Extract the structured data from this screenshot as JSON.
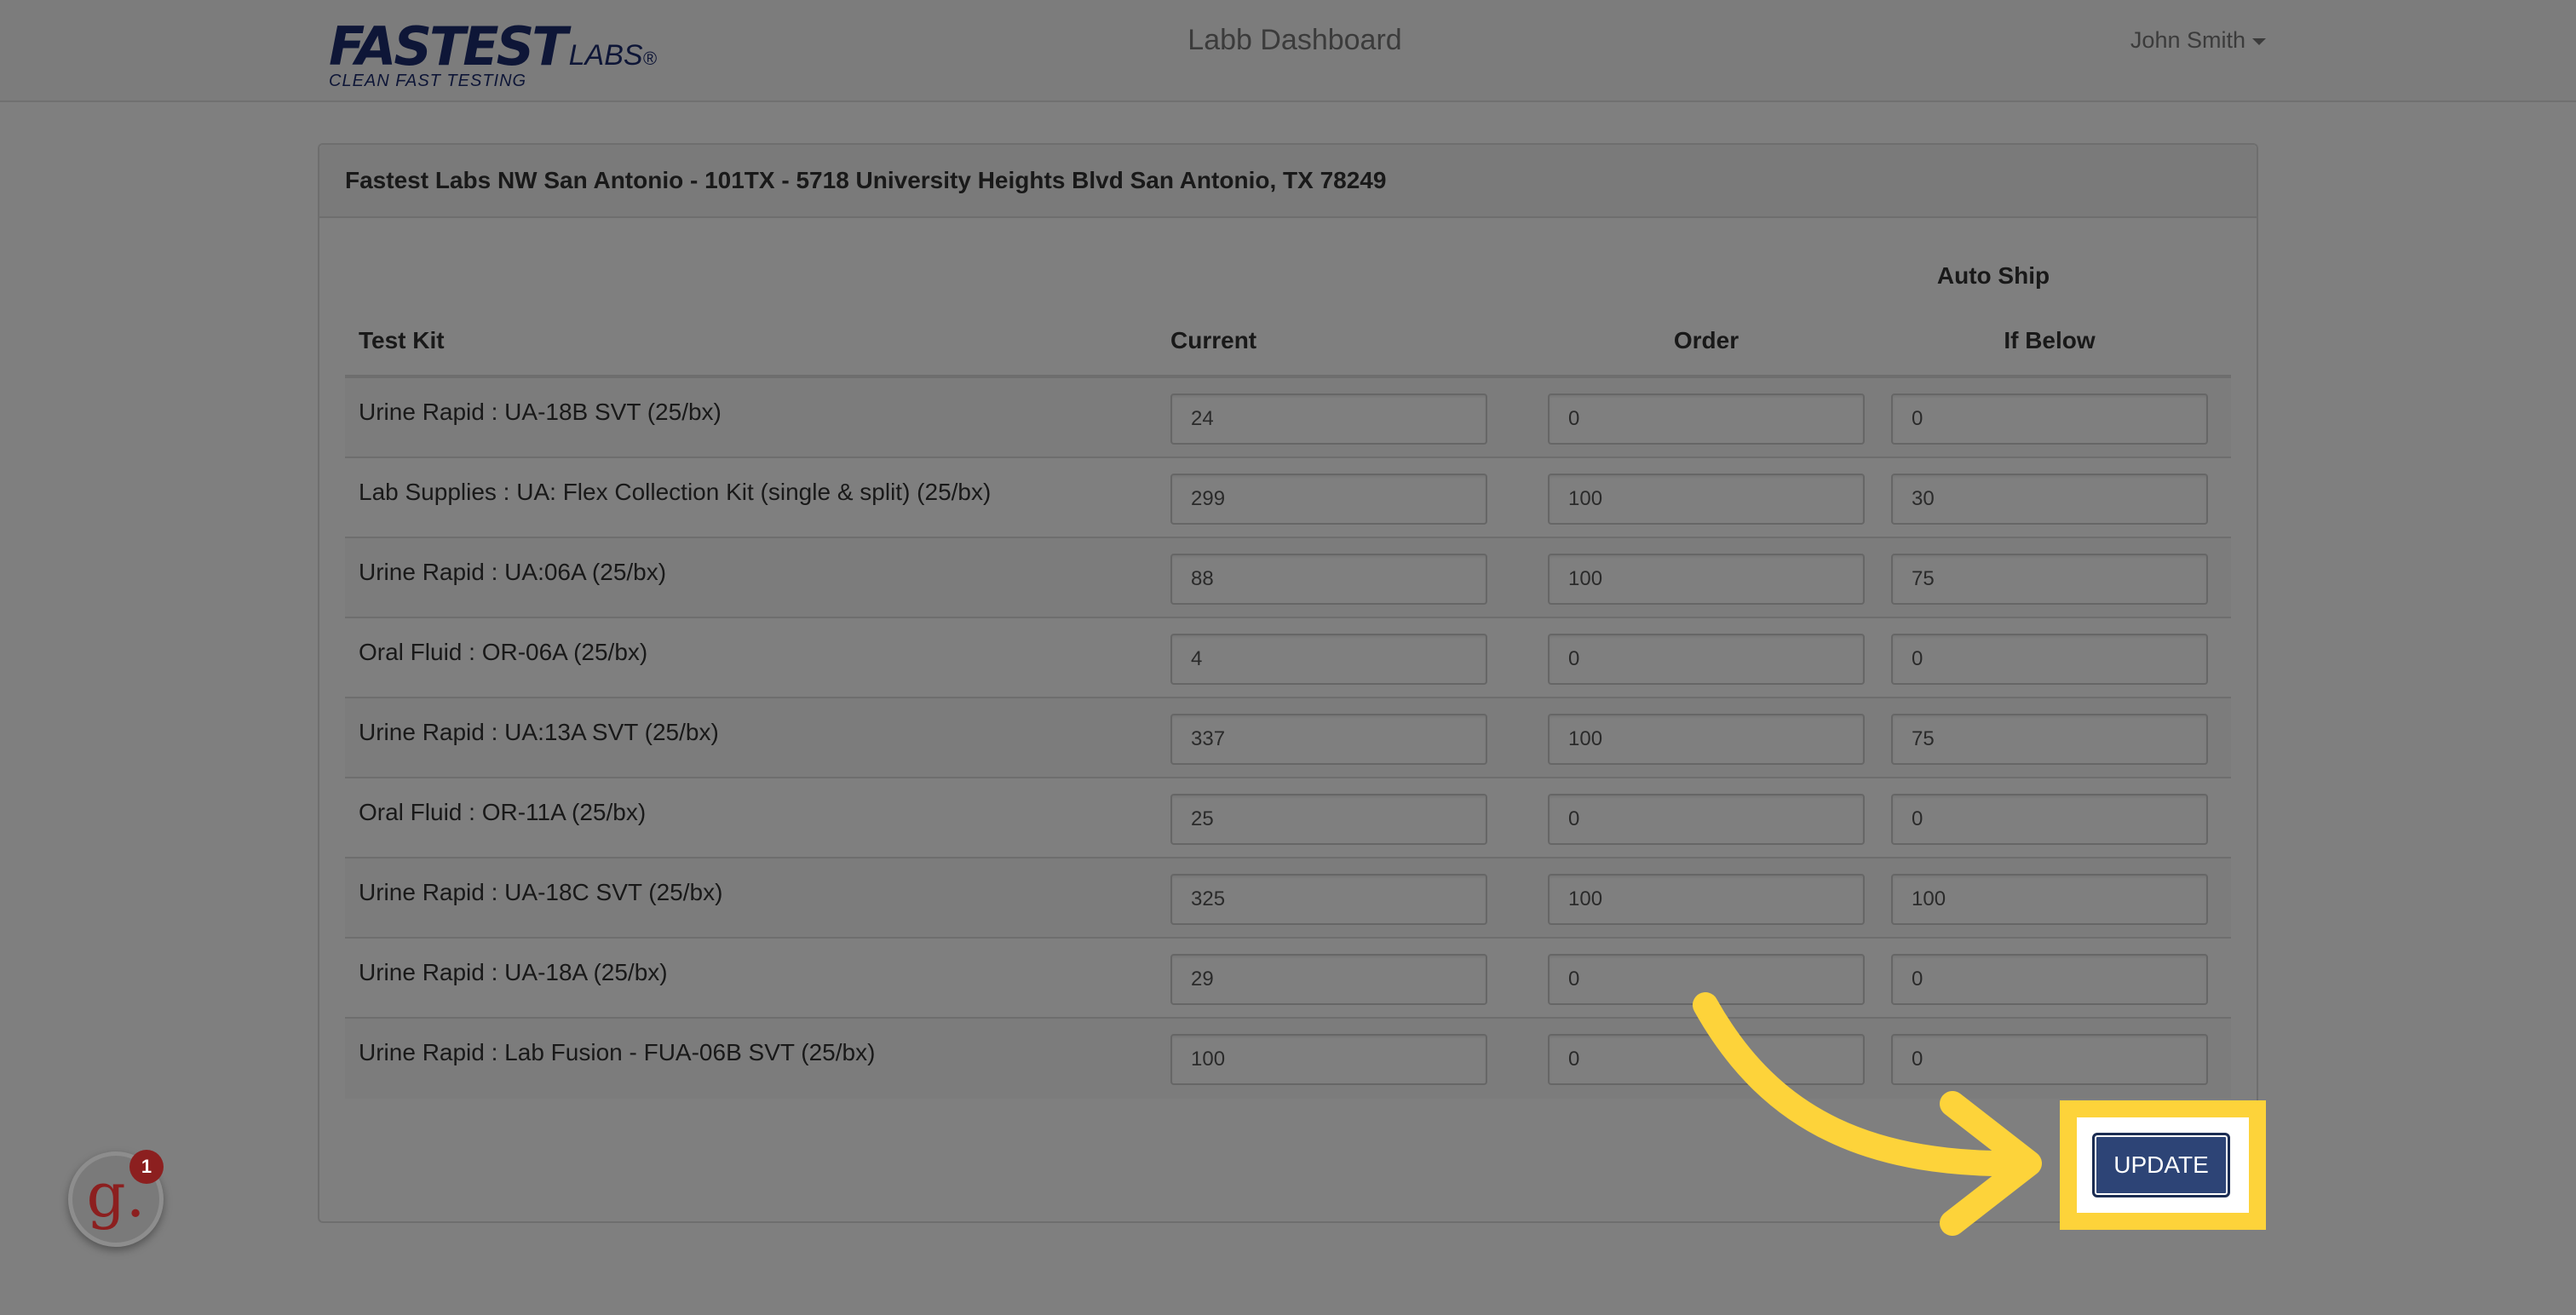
{
  "header": {
    "logo_main_1": "FAST",
    "logo_main_2": "EST",
    "logo_labs": "LABS",
    "logo_reg": "®",
    "logo_tagline": "CLEAN FAST TESTING",
    "title": "Labb Dashboard",
    "user_name": "John Smith"
  },
  "panel": {
    "title": "Fastest Labs NW San Antonio - 101TX - 5718 University Heights Blvd San Antonio, TX 78249"
  },
  "table": {
    "group_header": "Auto Ship",
    "columns": {
      "test_kit": "Test Kit",
      "current": "Current",
      "order": "Order",
      "if_below": "If Below"
    },
    "rows": [
      {
        "kit": "Urine Rapid : UA-18B SVT (25/bx)",
        "current": "24",
        "order": "0",
        "if_below": "0"
      },
      {
        "kit": "Lab Supplies : UA: Flex Collection Kit (single & split) (25/bx)",
        "current": "299",
        "order": "100",
        "if_below": "30"
      },
      {
        "kit": "Urine Rapid : UA:06A (25/bx)",
        "current": "88",
        "order": "100",
        "if_below": "75"
      },
      {
        "kit": "Oral Fluid : OR-06A (25/bx)",
        "current": "4",
        "order": "0",
        "if_below": "0"
      },
      {
        "kit": "Urine Rapid : UA:13A SVT (25/bx)",
        "current": "337",
        "order": "100",
        "if_below": "75"
      },
      {
        "kit": "Oral Fluid : OR-11A (25/bx)",
        "current": "25",
        "order": "0",
        "if_below": "0"
      },
      {
        "kit": "Urine Rapid : UA-18C SVT (25/bx)",
        "current": "325",
        "order": "100",
        "if_below": "100"
      },
      {
        "kit": "Urine Rapid : UA-18A (25/bx)",
        "current": "29",
        "order": "0",
        "if_below": "0"
      },
      {
        "kit": "Urine Rapid : Lab Fusion - FUA-06B SVT (25/bx)",
        "current": "100",
        "order": "0",
        "if_below": "0"
      }
    ]
  },
  "actions": {
    "update_label": "UPDATE"
  },
  "badge": {
    "letter": "g.",
    "count": "1"
  },
  "overlay": {
    "highlight_color": "#fdd33a",
    "dim_color": "#000000"
  },
  "icons": {
    "user_menu": "chevron-down-icon",
    "pointer": "curved-arrow-icon"
  }
}
